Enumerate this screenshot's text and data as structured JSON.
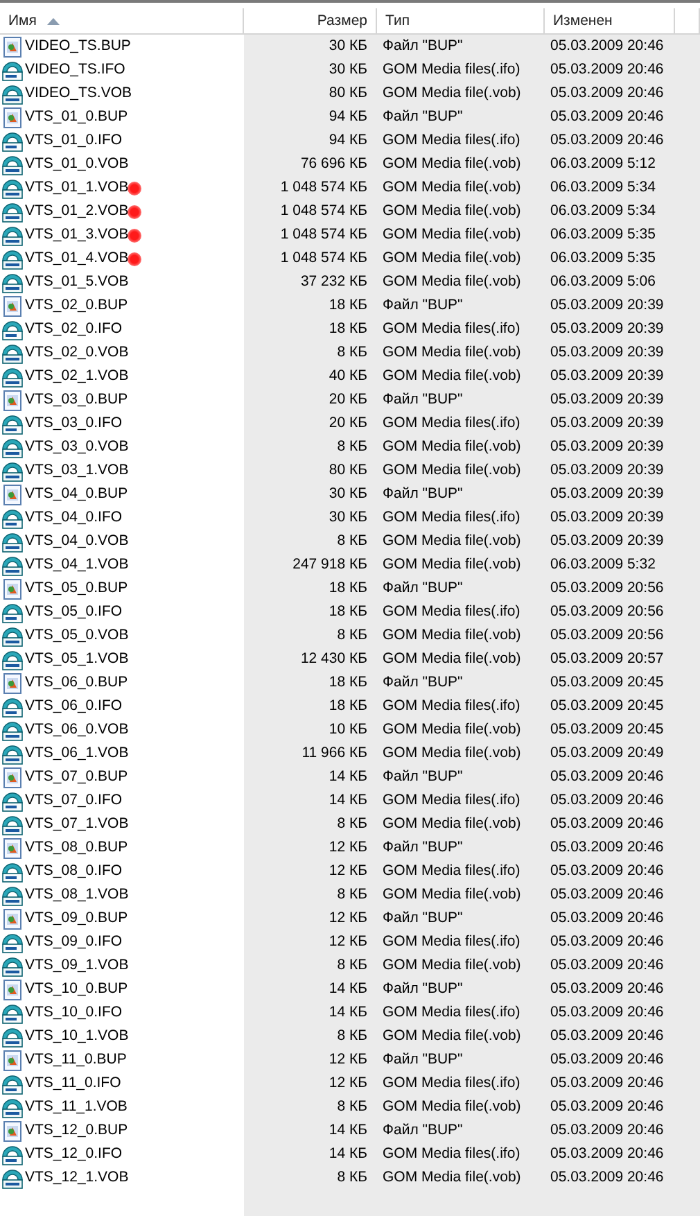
{
  "columns": [
    {
      "label": "Имя",
      "sorted": true
    },
    {
      "label": "Размер",
      "sorted": false
    },
    {
      "label": "Тип",
      "sorted": false
    },
    {
      "label": "Изменен",
      "sorted": false
    }
  ],
  "rows": [
    {
      "kind": "bup",
      "name": "VIDEO_TS.BUP",
      "size": "30 КБ",
      "type": "Файл \"BUP\"",
      "modified": "05.03.2009 20:46",
      "marked": false
    },
    {
      "kind": "ifo",
      "name": "VIDEO_TS.IFO",
      "size": "30 КБ",
      "type": "GOM Media files(.ifo)",
      "modified": "05.03.2009 20:46",
      "marked": false
    },
    {
      "kind": "vob",
      "name": "VIDEO_TS.VOB",
      "size": "80 КБ",
      "type": "GOM Media file(.vob)",
      "modified": "05.03.2009 20:46",
      "marked": false
    },
    {
      "kind": "bup",
      "name": "VTS_01_0.BUP",
      "size": "94 КБ",
      "type": "Файл \"BUP\"",
      "modified": "05.03.2009 20:46",
      "marked": false
    },
    {
      "kind": "ifo",
      "name": "VTS_01_0.IFO",
      "size": "94 КБ",
      "type": "GOM Media files(.ifo)",
      "modified": "05.03.2009 20:46",
      "marked": false
    },
    {
      "kind": "vob",
      "name": "VTS_01_0.VOB",
      "size": "76 696 КБ",
      "type": "GOM Media file(.vob)",
      "modified": "06.03.2009 5:12",
      "marked": false
    },
    {
      "kind": "vob",
      "name": "VTS_01_1.VOB",
      "size": "1 048 574 КБ",
      "type": "GOM Media file(.vob)",
      "modified": "06.03.2009 5:34",
      "marked": true
    },
    {
      "kind": "vob",
      "name": "VTS_01_2.VOB",
      "size": "1 048 574 КБ",
      "type": "GOM Media file(.vob)",
      "modified": "06.03.2009 5:34",
      "marked": true
    },
    {
      "kind": "vob",
      "name": "VTS_01_3.VOB",
      "size": "1 048 574 КБ",
      "type": "GOM Media file(.vob)",
      "modified": "06.03.2009 5:35",
      "marked": true
    },
    {
      "kind": "vob",
      "name": "VTS_01_4.VOB",
      "size": "1 048 574 КБ",
      "type": "GOM Media file(.vob)",
      "modified": "06.03.2009 5:35",
      "marked": true
    },
    {
      "kind": "vob",
      "name": "VTS_01_5.VOB",
      "size": "37 232 КБ",
      "type": "GOM Media file(.vob)",
      "modified": "06.03.2009 5:06",
      "marked": false
    },
    {
      "kind": "bup",
      "name": "VTS_02_0.BUP",
      "size": "18 КБ",
      "type": "Файл \"BUP\"",
      "modified": "05.03.2009 20:39",
      "marked": false
    },
    {
      "kind": "ifo",
      "name": "VTS_02_0.IFO",
      "size": "18 КБ",
      "type": "GOM Media files(.ifo)",
      "modified": "05.03.2009 20:39",
      "marked": false
    },
    {
      "kind": "vob",
      "name": "VTS_02_0.VOB",
      "size": "8 КБ",
      "type": "GOM Media file(.vob)",
      "modified": "05.03.2009 20:39",
      "marked": false
    },
    {
      "kind": "vob",
      "name": "VTS_02_1.VOB",
      "size": "40 КБ",
      "type": "GOM Media file(.vob)",
      "modified": "05.03.2009 20:39",
      "marked": false
    },
    {
      "kind": "bup",
      "name": "VTS_03_0.BUP",
      "size": "20 КБ",
      "type": "Файл \"BUP\"",
      "modified": "05.03.2009 20:39",
      "marked": false
    },
    {
      "kind": "ifo",
      "name": "VTS_03_0.IFO",
      "size": "20 КБ",
      "type": "GOM Media files(.ifo)",
      "modified": "05.03.2009 20:39",
      "marked": false
    },
    {
      "kind": "vob",
      "name": "VTS_03_0.VOB",
      "size": "8 КБ",
      "type": "GOM Media file(.vob)",
      "modified": "05.03.2009 20:39",
      "marked": false
    },
    {
      "kind": "vob",
      "name": "VTS_03_1.VOB",
      "size": "80 КБ",
      "type": "GOM Media file(.vob)",
      "modified": "05.03.2009 20:39",
      "marked": false
    },
    {
      "kind": "bup",
      "name": "VTS_04_0.BUP",
      "size": "30 КБ",
      "type": "Файл \"BUP\"",
      "modified": "05.03.2009 20:39",
      "marked": false
    },
    {
      "kind": "ifo",
      "name": "VTS_04_0.IFO",
      "size": "30 КБ",
      "type": "GOM Media files(.ifo)",
      "modified": "05.03.2009 20:39",
      "marked": false
    },
    {
      "kind": "vob",
      "name": "VTS_04_0.VOB",
      "size": "8 КБ",
      "type": "GOM Media file(.vob)",
      "modified": "05.03.2009 20:39",
      "marked": false
    },
    {
      "kind": "vob",
      "name": "VTS_04_1.VOB",
      "size": "247 918 КБ",
      "type": "GOM Media file(.vob)",
      "modified": "06.03.2009 5:32",
      "marked": false
    },
    {
      "kind": "bup",
      "name": "VTS_05_0.BUP",
      "size": "18 КБ",
      "type": "Файл \"BUP\"",
      "modified": "05.03.2009 20:56",
      "marked": false
    },
    {
      "kind": "ifo",
      "name": "VTS_05_0.IFO",
      "size": "18 КБ",
      "type": "GOM Media files(.ifo)",
      "modified": "05.03.2009 20:56",
      "marked": false
    },
    {
      "kind": "vob",
      "name": "VTS_05_0.VOB",
      "size": "8 КБ",
      "type": "GOM Media file(.vob)",
      "modified": "05.03.2009 20:56",
      "marked": false
    },
    {
      "kind": "vob",
      "name": "VTS_05_1.VOB",
      "size": "12 430 КБ",
      "type": "GOM Media file(.vob)",
      "modified": "05.03.2009 20:57",
      "marked": false
    },
    {
      "kind": "bup",
      "name": "VTS_06_0.BUP",
      "size": "18 КБ",
      "type": "Файл \"BUP\"",
      "modified": "05.03.2009 20:45",
      "marked": false
    },
    {
      "kind": "ifo",
      "name": "VTS_06_0.IFO",
      "size": "18 КБ",
      "type": "GOM Media files(.ifo)",
      "modified": "05.03.2009 20:45",
      "marked": false
    },
    {
      "kind": "vob",
      "name": "VTS_06_0.VOB",
      "size": "10 КБ",
      "type": "GOM Media file(.vob)",
      "modified": "05.03.2009 20:45",
      "marked": false
    },
    {
      "kind": "vob",
      "name": "VTS_06_1.VOB",
      "size": "11 966 КБ",
      "type": "GOM Media file(.vob)",
      "modified": "05.03.2009 20:49",
      "marked": false
    },
    {
      "kind": "bup",
      "name": "VTS_07_0.BUP",
      "size": "14 КБ",
      "type": "Файл \"BUP\"",
      "modified": "05.03.2009 20:46",
      "marked": false
    },
    {
      "kind": "ifo",
      "name": "VTS_07_0.IFO",
      "size": "14 КБ",
      "type": "GOM Media files(.ifo)",
      "modified": "05.03.2009 20:46",
      "marked": false
    },
    {
      "kind": "vob",
      "name": "VTS_07_1.VOB",
      "size": "8 КБ",
      "type": "GOM Media file(.vob)",
      "modified": "05.03.2009 20:46",
      "marked": false
    },
    {
      "kind": "bup",
      "name": "VTS_08_0.BUP",
      "size": "12 КБ",
      "type": "Файл \"BUP\"",
      "modified": "05.03.2009 20:46",
      "marked": false
    },
    {
      "kind": "ifo",
      "name": "VTS_08_0.IFO",
      "size": "12 КБ",
      "type": "GOM Media files(.ifo)",
      "modified": "05.03.2009 20:46",
      "marked": false
    },
    {
      "kind": "vob",
      "name": "VTS_08_1.VOB",
      "size": "8 КБ",
      "type": "GOM Media file(.vob)",
      "modified": "05.03.2009 20:46",
      "marked": false
    },
    {
      "kind": "bup",
      "name": "VTS_09_0.BUP",
      "size": "12 КБ",
      "type": "Файл \"BUP\"",
      "modified": "05.03.2009 20:46",
      "marked": false
    },
    {
      "kind": "ifo",
      "name": "VTS_09_0.IFO",
      "size": "12 КБ",
      "type": "GOM Media files(.ifo)",
      "modified": "05.03.2009 20:46",
      "marked": false
    },
    {
      "kind": "vob",
      "name": "VTS_09_1.VOB",
      "size": "8 КБ",
      "type": "GOM Media file(.vob)",
      "modified": "05.03.2009 20:46",
      "marked": false
    },
    {
      "kind": "bup",
      "name": "VTS_10_0.BUP",
      "size": "14 КБ",
      "type": "Файл \"BUP\"",
      "modified": "05.03.2009 20:46",
      "marked": false
    },
    {
      "kind": "ifo",
      "name": "VTS_10_0.IFO",
      "size": "14 КБ",
      "type": "GOM Media files(.ifo)",
      "modified": "05.03.2009 20:46",
      "marked": false
    },
    {
      "kind": "vob",
      "name": "VTS_10_1.VOB",
      "size": "8 КБ",
      "type": "GOM Media file(.vob)",
      "modified": "05.03.2009 20:46",
      "marked": false
    },
    {
      "kind": "bup",
      "name": "VTS_11_0.BUP",
      "size": "12 КБ",
      "type": "Файл \"BUP\"",
      "modified": "05.03.2009 20:46",
      "marked": false
    },
    {
      "kind": "ifo",
      "name": "VTS_11_0.IFO",
      "size": "12 КБ",
      "type": "GOM Media files(.ifo)",
      "modified": "05.03.2009 20:46",
      "marked": false
    },
    {
      "kind": "vob",
      "name": "VTS_11_1.VOB",
      "size": "8 КБ",
      "type": "GOM Media file(.vob)",
      "modified": "05.03.2009 20:46",
      "marked": false
    },
    {
      "kind": "bup",
      "name": "VTS_12_0.BUP",
      "size": "14 КБ",
      "type": "Файл \"BUP\"",
      "modified": "05.03.2009 20:46",
      "marked": false
    },
    {
      "kind": "ifo",
      "name": "VTS_12_0.IFO",
      "size": "14 КБ",
      "type": "GOM Media files(.ifo)",
      "modified": "05.03.2009 20:46",
      "marked": false
    },
    {
      "kind": "vob",
      "name": "VTS_12_1.VOB",
      "size": "8 КБ",
      "type": "GOM Media file(.vob)",
      "modified": "05.03.2009 20:46",
      "marked": false
    }
  ]
}
